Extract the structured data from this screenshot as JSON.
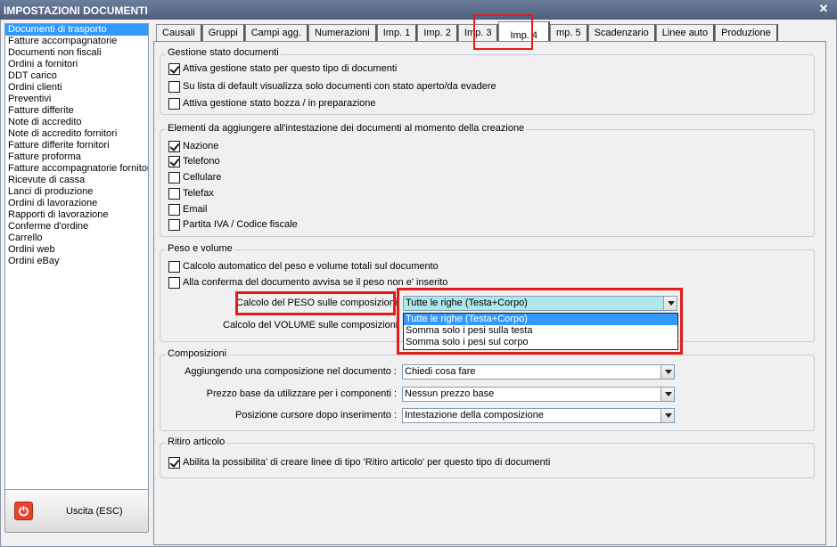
{
  "window": {
    "title": "IMPOSTAZIONI DOCUMENTI",
    "close_glyph": "✕"
  },
  "doc_types": [
    "Documenti di trasporto",
    "Fatture accompagnatorie",
    "Documenti non fiscali",
    "Ordini a fornitori",
    "DDT carico",
    "Ordini clienti",
    "Preventivi",
    "Fatture differite",
    "Note di accredito",
    "Note di accredito fornitori",
    "Fatture differite fornitori",
    "Fatture proforma",
    "Fatture accompagnatorie fornitori",
    "Ricevute di cassa",
    "Lanci di produzione",
    "Ordini di lavorazione",
    "Rapporti di lavorazione",
    "Conferme d'ordine",
    "Carrello",
    "Ordini web",
    "Ordini eBay"
  ],
  "selected_doc_index": 0,
  "exit_button": {
    "label": "Uscita (ESC)",
    "icon": "power-icon"
  },
  "tabs": [
    "Causali",
    "Gruppi",
    "Campi agg.",
    "Numerazioni",
    "Imp. 1",
    "Imp. 2",
    "Imp. 3",
    "Imp. 4",
    "Imp. 5",
    "Scadenzario",
    "Linee auto",
    "Produzione"
  ],
  "tabs_display": [
    "Causali",
    "Gruppi",
    "Campi agg.",
    "Numerazioni",
    "Imp. 1",
    "Imp. 2",
    "Imp. 3",
    "Imp. 4",
    "mp. 5",
    "Scadenzario",
    "Linee auto",
    "Produzione"
  ],
  "active_tab": "Imp. 4",
  "sections": {
    "stato": {
      "title": "Gestione stato documenti",
      "options": [
        {
          "label": "Attiva gestione stato per questo tipo di documenti",
          "checked": true
        },
        {
          "label": "Su lista di default visualizza solo documenti con stato aperto/da evadere",
          "checked": false
        },
        {
          "label": "Attiva gestione stato bozza / in preparazione",
          "checked": false
        }
      ]
    },
    "intestazione": {
      "title": "Elementi da aggiungere all'intestazione dei documenti al momento della creazione",
      "options": [
        {
          "label": "Nazione",
          "checked": true
        },
        {
          "label": "Telefono",
          "checked": true
        },
        {
          "label": "Cellulare",
          "checked": false
        },
        {
          "label": "Telefax",
          "checked": false
        },
        {
          "label": "Email",
          "checked": false
        },
        {
          "label": "Partita IVA / Codice fiscale",
          "checked": false
        }
      ]
    },
    "peso": {
      "title": "Peso e volume",
      "options": [
        {
          "label": "Calcolo automatico del peso e volume totali sul documento",
          "checked": false
        },
        {
          "label": "Alla conferma del documento avvisa se il peso non e' inserito",
          "checked": false
        }
      ],
      "peso_label": "Calcolo del PESO sulle composizioni",
      "peso_value": "Tutte le righe (Testa+Corpo)",
      "volume_label": "Calcolo del VOLUME sulle composizioni",
      "dropdown_options": [
        "Tutte le righe (Testa+Corpo)",
        "Somma solo i pesi sulla testa",
        "Somma solo i pesi sul corpo"
      ]
    },
    "composizioni": {
      "title": "Composizioni",
      "rows": [
        {
          "label": "Aggiungendo una composizione nel documento :",
          "value": "Chiedi cosa fare"
        },
        {
          "label": "Prezzo base da utilizzare per i componenti :",
          "value": "Nessun prezzo base"
        },
        {
          "label": "Posizione cursore dopo inserimento :",
          "value": "Intestazione della composizione"
        }
      ]
    },
    "ritiro": {
      "title": "Ritiro articolo",
      "option": {
        "label": "Abilita la possibilita' di creare linee di tipo 'Ritiro articolo' per questo tipo di documenti",
        "checked": true
      }
    }
  },
  "colors": {
    "selection": "#3399ff",
    "highlight": "#e21c1c",
    "dropdown_field": "#aee8ea"
  }
}
